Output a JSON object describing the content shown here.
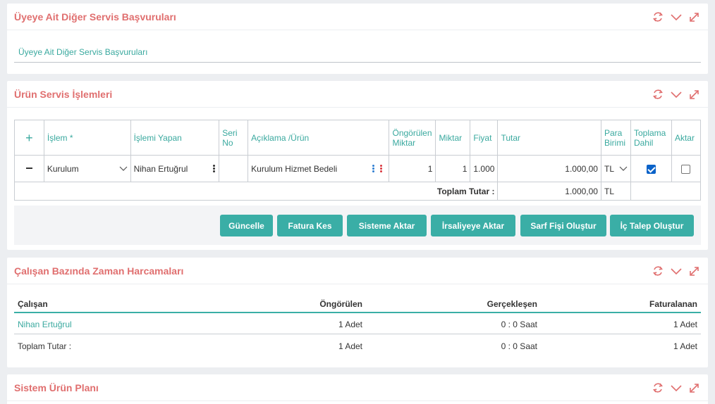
{
  "panels": {
    "applications": {
      "title": "Üyeye Ait Diğer Servis Başvuruları",
      "link": "Üyeye Ait Diğer Servis Başvuruları"
    },
    "product_ops": {
      "title": "Ürün Servis İşlemleri",
      "headers": {
        "islem": "İşlem *",
        "islemi_yapan": "İşlemi Yapan",
        "seri_no": "Seri No",
        "aciklama": "Açıklama /Ürün",
        "ongorulen": "Öngörülen Miktar",
        "miktar": "Miktar",
        "fiyat": "Fiyat",
        "tutar": "Tutar",
        "para_birimi": "Para Birimi",
        "toplama_dahil": "Toplama Dahil",
        "aktar": "Aktar"
      },
      "row": {
        "islem": "Kurulum",
        "islemi_yapan": "Nihan Ertuğrul",
        "seri_no": "",
        "aciklama": "Kurulum Hizmet Bedeli",
        "ongorulen": "1",
        "miktar": "1",
        "fiyat": "1.000",
        "tutar": "1.000,00",
        "para_birimi": "TL",
        "toplama_dahil": true,
        "aktar": false
      },
      "total": {
        "label": "Toplam Tutar :",
        "value": "1.000,00",
        "currency": "TL"
      },
      "buttons": {
        "guncelle": "Güncelle",
        "fatura": "Fatura Kes",
        "sisteme": "Sisteme Aktar",
        "irsaliye": "İrsaliyeye Aktar",
        "sarf": "Sarf Fişi Oluştur",
        "ic_talep": "İç Talep Oluştur"
      }
    },
    "time_spent": {
      "title": "Çalışan Bazında Zaman Harcamaları",
      "headers": {
        "calisan": "Çalışan",
        "ongorulen": "Öngörülen",
        "gerceklesen": "Gerçekleşen",
        "faturalanan": "Faturalanan"
      },
      "row": {
        "calisan": "Nihan Ertuğrul",
        "ongorulen": "1 Adet",
        "gerceklesen": "0 : 0 Saat",
        "faturalanan": "1 Adet"
      },
      "total": {
        "label": "Toplam Tutar :",
        "ongorulen": "1 Adet",
        "gerceklesen": "0 : 0 Saat",
        "faturalanan": "1 Adet"
      }
    },
    "system_plan": {
      "title": "Sistem Ürün Planı"
    }
  },
  "colors": {
    "title": "#e06f6f",
    "accent": "#3aaea6",
    "link": "#3aa99f"
  },
  "icons": [
    "refresh-icon",
    "chevron-down-icon",
    "expand-icon"
  ]
}
